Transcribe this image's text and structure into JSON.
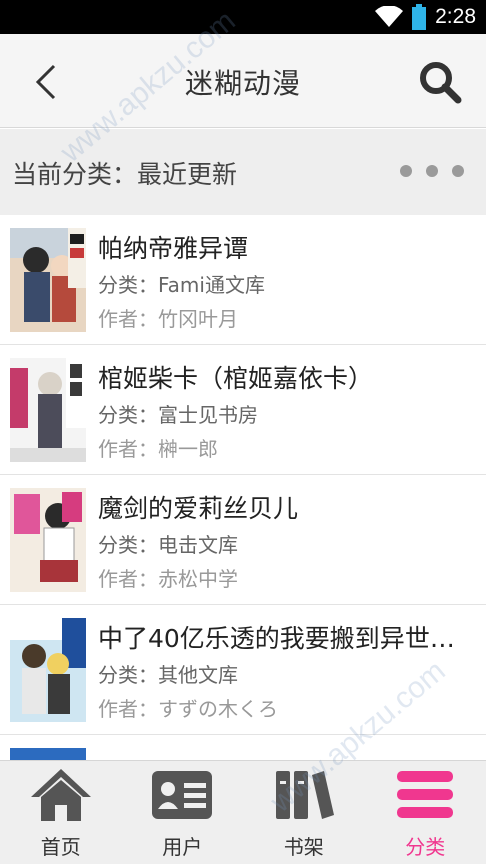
{
  "status_bar": {
    "time": "2:28"
  },
  "header": {
    "title": "迷糊动漫"
  },
  "category": {
    "label": "当前分类：最近更新"
  },
  "books": [
    {
      "title": "帕纳帝雅异谭",
      "category": "分类：Fami通文库",
      "author": "作者：竹冈叶月"
    },
    {
      "title": "棺姬柴卡（棺姬嘉依卡）",
      "category": "分类：富士见书房",
      "author": "作者：榊一郎"
    },
    {
      "title": "魔剑的爱莉丝贝儿",
      "category": "分类：电击文库",
      "author": "作者：赤松中学"
    },
    {
      "title": "中了40亿乐透的我要搬到异世…",
      "category": "分类：其他文库",
      "author": "作者：すずの木くろ"
    }
  ],
  "nav": {
    "home": "首页",
    "user": "用户",
    "shelf": "书架",
    "category": "分类"
  },
  "colors": {
    "accent": "#f0378f",
    "icon_gray": "#555555"
  },
  "watermark": "www.apkzu.com"
}
